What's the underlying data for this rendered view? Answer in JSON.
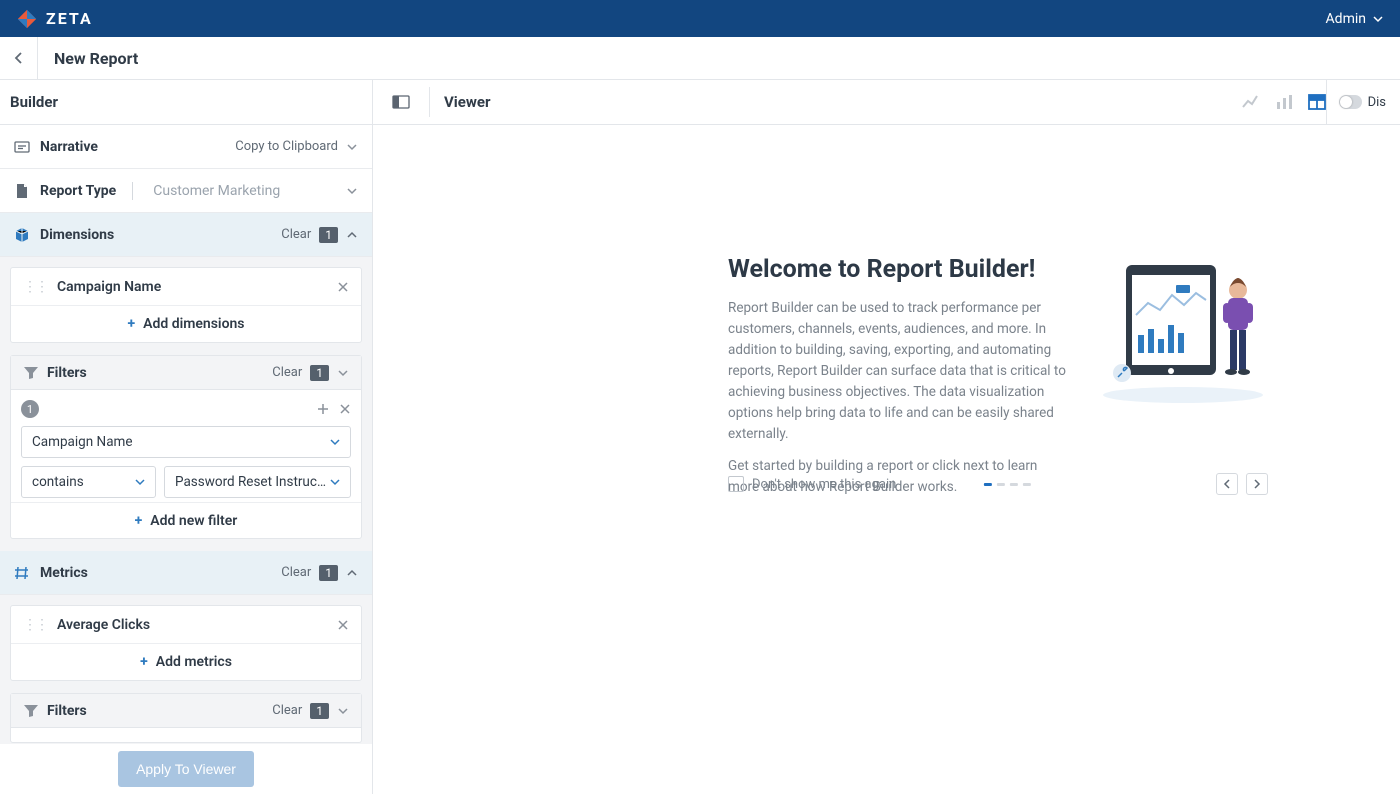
{
  "brand": {
    "name": "ZETA"
  },
  "user": {
    "label": "Admin"
  },
  "page": {
    "title": "New Report"
  },
  "builder": {
    "title": "Builder",
    "apply_label": "Apply To Viewer",
    "narrative": {
      "label": "Narrative",
      "action": "Copy to Clipboard"
    },
    "report_type": {
      "label": "Report Type",
      "value": "Customer Marketing"
    },
    "dimensions": {
      "label": "Dimensions",
      "clear": "Clear",
      "count": "1",
      "items": [
        "Campaign Name"
      ],
      "add_label": "Add dimensions"
    },
    "dim_filters": {
      "label": "Filters",
      "clear": "Clear",
      "count": "1",
      "group_index": "1",
      "field": "Campaign Name",
      "operator": "contains",
      "value": "Password Reset Instructio...",
      "add_label": "Add new filter"
    },
    "metrics": {
      "label": "Metrics",
      "clear": "Clear",
      "count": "1",
      "items": [
        "Average Clicks"
      ],
      "add_label": "Add metrics"
    },
    "met_filters": {
      "label": "Filters",
      "clear": "Clear",
      "count": "1"
    }
  },
  "viewer": {
    "title": "Viewer",
    "right_label": "Dis",
    "welcome": {
      "heading": "Welcome to Report Builder!",
      "p1": "Report Builder can be used to track performance per customers, channels, events, audiences, and more. In addition to building, saving, exporting, and automating reports, Report Builder can surface data that is critical to achieving business objectives. The data visualization options help bring data to life and can be easily shared externally.",
      "p2": "Get started by building a report or click next to learn more about how Report Builder works.",
      "dont_show": "Don't show me this again"
    }
  }
}
